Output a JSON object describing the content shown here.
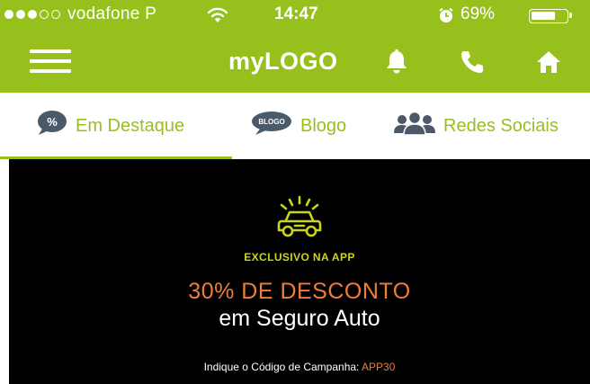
{
  "colors": {
    "brand_green": "#98c01d",
    "banner_bg": "#000000",
    "accent_orange": "#f07d36",
    "accent_lime": "#c8d51a"
  },
  "status_bar": {
    "carrier": "vodafone P",
    "time": "14:47",
    "battery_percent": "69%",
    "battery_level": 0.69,
    "signal_bars_filled": 3,
    "signal_bars_total": 5,
    "icons": [
      "wifi-icon",
      "alarm-icon",
      "battery-icon"
    ]
  },
  "nav_bar": {
    "logo_text": "myLOGO",
    "icons": [
      "menu-icon",
      "bell-icon",
      "phone-icon",
      "home-icon"
    ]
  },
  "tabs": [
    {
      "label": "Em Destaque",
      "icon": "percent-icon",
      "active": true
    },
    {
      "label": "Blogo",
      "icon": "blogo-bubble-icon",
      "icon_text": "BLOGO",
      "active": false
    },
    {
      "label": "Redes Sociais",
      "icon": "people-icon",
      "active": false
    }
  ],
  "banner": {
    "icon": "car-icon",
    "tagline": "EXCLUSIVO NA APP",
    "headline": "30% DE DESCONTO",
    "subheadline": "em Seguro Auto",
    "campaign_prefix": "Indique o Código de Campanha: ",
    "campaign_code": "APP30"
  }
}
